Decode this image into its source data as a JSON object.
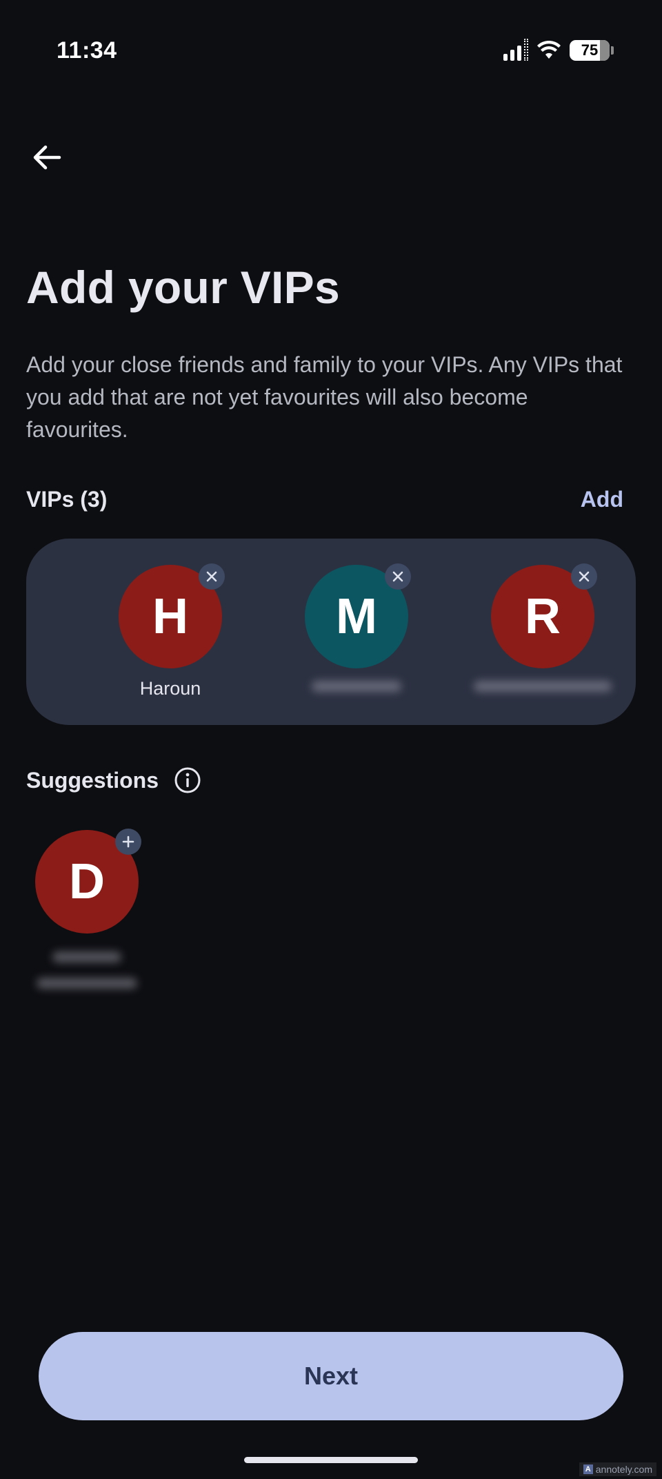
{
  "status_bar": {
    "time": "11:34",
    "battery_level": "75",
    "icons": [
      "signal-icon",
      "wifi-icon",
      "battery-icon"
    ]
  },
  "header": {
    "back_icon": "arrow-left-icon",
    "title": "Add your VIPs",
    "description": "Add your close friends and family to your VIPs. Any VIPs that you add that are not yet favourites will also become favourites."
  },
  "vips": {
    "heading": "VIPs (3)",
    "add_label": "Add",
    "items": [
      {
        "initial": "H",
        "name": "Haroun",
        "color": "#8c1c17",
        "name_blurred": false
      },
      {
        "initial": "M",
        "name": "",
        "color": "#0b5660",
        "name_blurred": true
      },
      {
        "initial": "R",
        "name": "",
        "color": "#8c1c17",
        "name_blurred": true
      }
    ]
  },
  "suggestions": {
    "heading": "Suggestions",
    "info_icon": "info-icon",
    "items": [
      {
        "initial": "D",
        "name": "",
        "color": "#8c1c17",
        "name_blurred": true
      }
    ]
  },
  "footer": {
    "next_label": "Next"
  },
  "watermark": {
    "text": "annotely.com"
  },
  "colors": {
    "background": "#0d0e12",
    "card": "#2c3142",
    "accent": "#b8c4ec",
    "badge": "#3e4963"
  }
}
